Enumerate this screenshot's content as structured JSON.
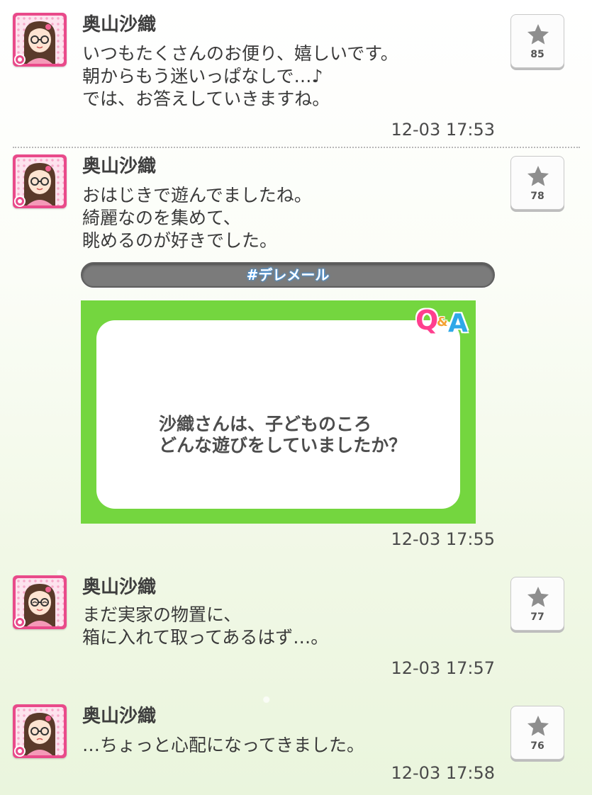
{
  "posts": [
    {
      "name": "奥山沙織",
      "lines": [
        "いつもたくさんのお便り、嬉しいです。",
        "朝からもう迷いっぱなしで…♪",
        "では、お答えしていきますね。"
      ],
      "time": "12-03 17:53",
      "stars": "85",
      "expression": "smile"
    },
    {
      "name": "奥山沙織",
      "lines": [
        "おはじきで遊んでましたね。",
        "綺麗なのを集めて、",
        "眺めるのが好きでした。"
      ],
      "hashtag": "#デレメール",
      "qa": {
        "logo_q": "Q",
        "logo_amp": "&",
        "logo_a": "A",
        "question_lines": [
          "沙織さんは、子どものころ",
          "どんな遊びをしていましたか？"
        ]
      },
      "time": "12-03 17:55",
      "stars": "78",
      "expression": "smile"
    },
    {
      "name": "奥山沙織",
      "lines": [
        "まだ実家の物置に、",
        "箱に入れて取ってあるはず…。"
      ],
      "time": "12-03 17:57",
      "stars": "77",
      "expression": "closed-eyes"
    },
    {
      "name": "奥山沙織",
      "lines": [
        "…ちょっと心配になってきました。"
      ],
      "time": "12-03 17:58",
      "stars": "76",
      "expression": "worried"
    }
  ],
  "colors": {
    "avatar_frame": "#e94a8a",
    "qa_green": "#74d63f",
    "hashtag_bar": "#7b7b7b"
  },
  "icons": {
    "star_button": "star-icon",
    "avatar": "character-portrait-icon"
  }
}
